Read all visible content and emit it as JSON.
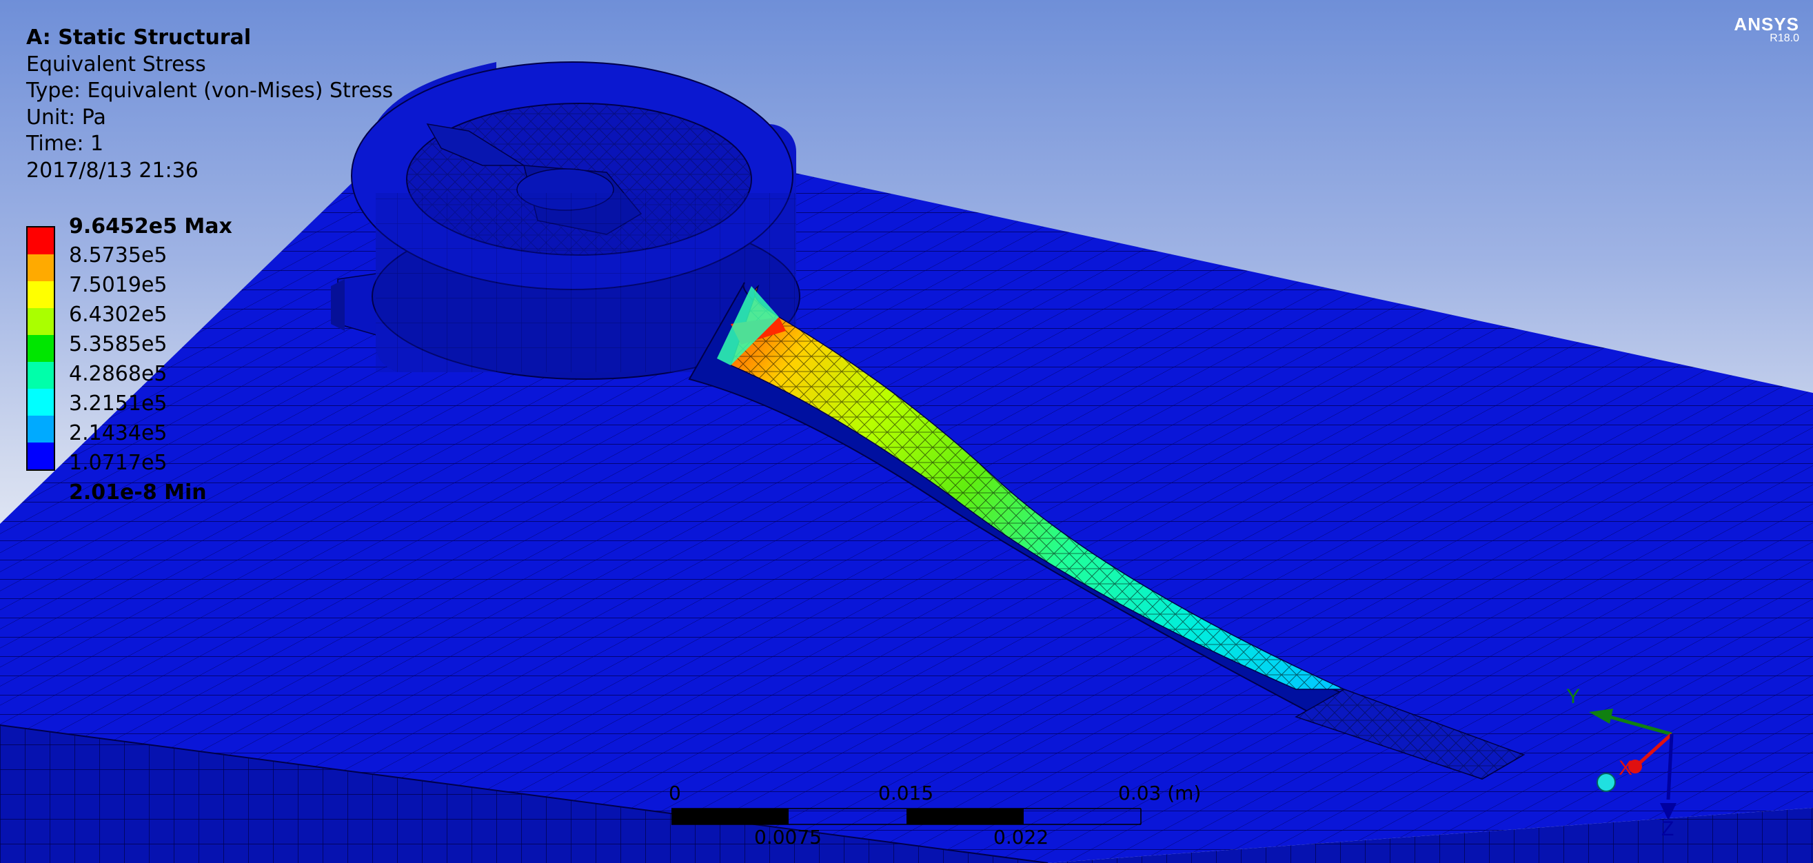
{
  "header": {
    "title": "A: Static Structural",
    "result": "Equivalent Stress",
    "type": "Type: Equivalent (von-Mises) Stress",
    "unit": "Unit: Pa",
    "time": "Time: 1",
    "timestamp": "2017/8/13 21:36"
  },
  "logo": {
    "brand": "ANSYS",
    "version": "R18.0"
  },
  "legend": {
    "labels": [
      "9.6452e5 Max",
      "8.5735e5",
      "7.5019e5",
      "6.4302e5",
      "5.3585e5",
      "4.2868e5",
      "3.2151e5",
      "2.1434e5",
      "1.0717e5",
      "2.01e-8 Min"
    ],
    "colors": [
      "#ff0000",
      "#ffaa00",
      "#ffff00",
      "#aaff00",
      "#00e600",
      "#00ffaa",
      "#00ffff",
      "#00aaff",
      "#0000ff"
    ]
  },
  "scale_bar": {
    "top_labels": [
      "0",
      "0.015",
      "0.03 (m)"
    ],
    "bottom_labels": [
      "0.0075",
      "0.022"
    ]
  },
  "triad": {
    "y": "Y",
    "x": "X",
    "z": "Z"
  }
}
